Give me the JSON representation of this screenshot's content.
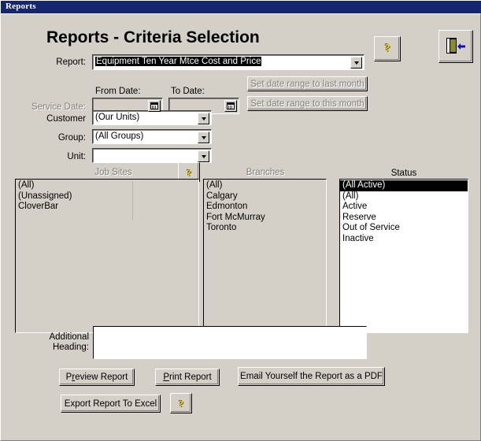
{
  "window": {
    "title": "Reports"
  },
  "header": {
    "page_title": "Reports - Criteria Selection",
    "help_button": "?",
    "help_icon_name": "question-mark-icon",
    "exit_button_name": "exit-door-icon"
  },
  "report_row": {
    "label": "Report:",
    "value": "Equipment Ten Year Mtce Cost and Price"
  },
  "service_date": {
    "label": "Service Date:",
    "from_label": "From Date:",
    "to_label": "To Date:",
    "from_value": "",
    "to_value": "",
    "set_last_month": "Set date range  to last month",
    "set_this_month": "Set date range  to this month",
    "enabled": false
  },
  "customer": {
    "label": "Customer",
    "value": "(Our Units)"
  },
  "group": {
    "label": "Group:",
    "value": "(All Groups)"
  },
  "unit": {
    "label": "Unit:",
    "value": ""
  },
  "job_sites": {
    "label": "Job Sites",
    "enabled": false,
    "items": [
      "(All)",
      "(Unassigned)",
      "CloverBar"
    ],
    "selected": []
  },
  "branches": {
    "label": "Branches",
    "enabled": false,
    "items": [
      "(All)",
      "Calgary",
      "Edmonton",
      "Fort McMurray",
      "Toronto"
    ],
    "selected": []
  },
  "status": {
    "label": "Status",
    "enabled": true,
    "items": [
      "(All Active)",
      "(All)",
      "Active",
      "Reserve",
      "Out of Service",
      "Inactive"
    ],
    "selected": [
      "(All Active)"
    ]
  },
  "additional_heading": {
    "label_line1": "Additional",
    "label_line2": "Heading:",
    "value": ""
  },
  "actions": {
    "preview_report": "Preview Report",
    "preview_report_accel": "r",
    "print_report": "Print Report",
    "print_report_accel": "P",
    "email_pdf": "Email Yourself the Report as a PDF",
    "export_excel": "Export Report To Excel",
    "bottom_help": "?"
  },
  "colors": {
    "titlebar": "#15266e",
    "face": "#d4d0c8",
    "selection": "#000000",
    "help_yellow": "#ffe000",
    "door": "#8a8a2a",
    "arrow_blue": "#1010c0"
  }
}
